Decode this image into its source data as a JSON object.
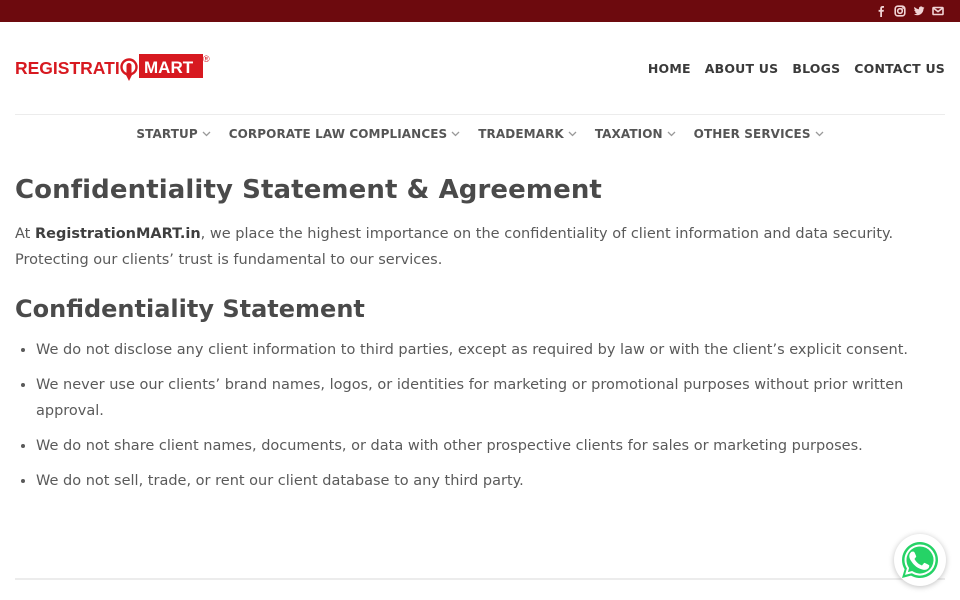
{
  "topbar": {
    "social": [
      {
        "name": "facebook-icon"
      },
      {
        "name": "instagram-icon"
      },
      {
        "name": "twitter-icon"
      },
      {
        "name": "email-icon"
      }
    ]
  },
  "logo": {
    "text_left": "REGISTRATI",
    "text_right": "MART",
    "registered": "®",
    "brand_color": "#d71920"
  },
  "main_nav": [
    "HOME",
    "ABOUT US",
    "BLOGS",
    "CONTACT US"
  ],
  "sub_nav": [
    "STARTUP",
    "CORPORATE LAW COMPLIANCES",
    "TRADEMARK",
    "TAXATION",
    "OTHER SERVICES"
  ],
  "page": {
    "title": "Confidentiality Statement & Agreement",
    "intro_prefix": "At ",
    "intro_brand": "RegistrationMART.in",
    "intro_rest": ", we place the highest importance on the confidentiality of client information and data security. Protecting our clients’ trust is fundamental to our services.",
    "section_heading": "Confidentiality Statement",
    "points": [
      "We do not disclose any client information to third parties, except as required by law or with the client’s explicit consent.",
      "We never use our clients’ brand names, logos, or identities for marketing or promotional purposes without prior written approval.",
      "We do not share client names, documents, or data with other prospective clients for sales or marketing purposes.",
      "We do not sell, trade, or rent our client database to any third party."
    ]
  },
  "colors": {
    "topbar": "#6d0a0e",
    "whatsapp": "#25d366"
  }
}
